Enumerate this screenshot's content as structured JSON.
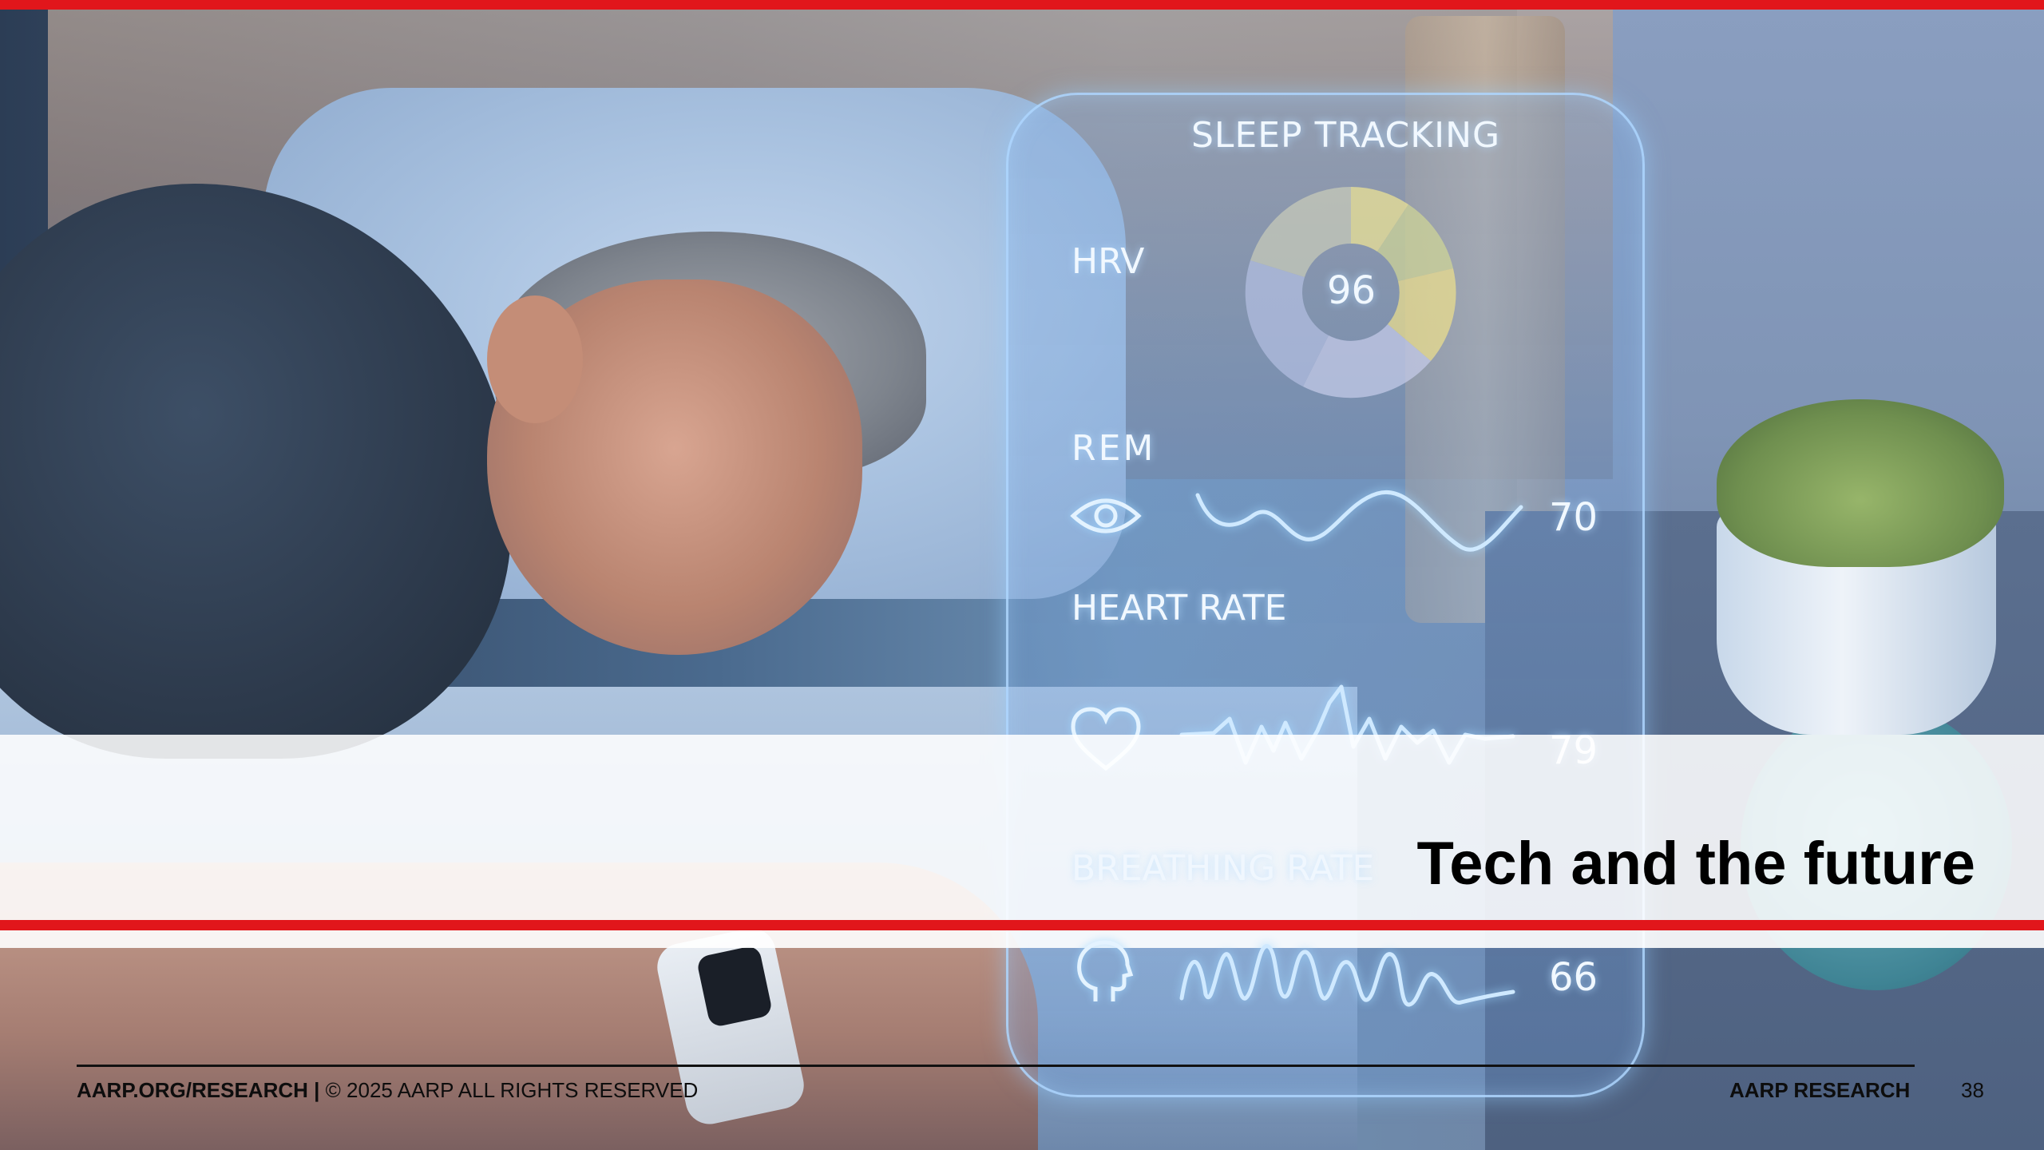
{
  "slide": {
    "title": "Tech and the future",
    "page_number": "38"
  },
  "panel": {
    "title": "SLEEP TRACKING",
    "hrv": {
      "label": "HRV",
      "value": "96"
    },
    "rem": {
      "label": "REM",
      "value": "70"
    },
    "heart_rate": {
      "label": "HEART RATE",
      "value": "79"
    },
    "breathing_rate": {
      "label": "BREATHING RATE",
      "value": "66"
    }
  },
  "footer": {
    "site": "AARP.ORG/RESEARCH",
    "separator": " | ",
    "copyright": "© 2025 AARP ALL RIGHTS RESERVED",
    "brand": "AARP RESEARCH"
  },
  "colors": {
    "accent_red": "#e1161b",
    "panel_glow": "#cfe9ff"
  },
  "icons": [
    "eye-icon",
    "heart-icon",
    "head-profile-icon"
  ]
}
